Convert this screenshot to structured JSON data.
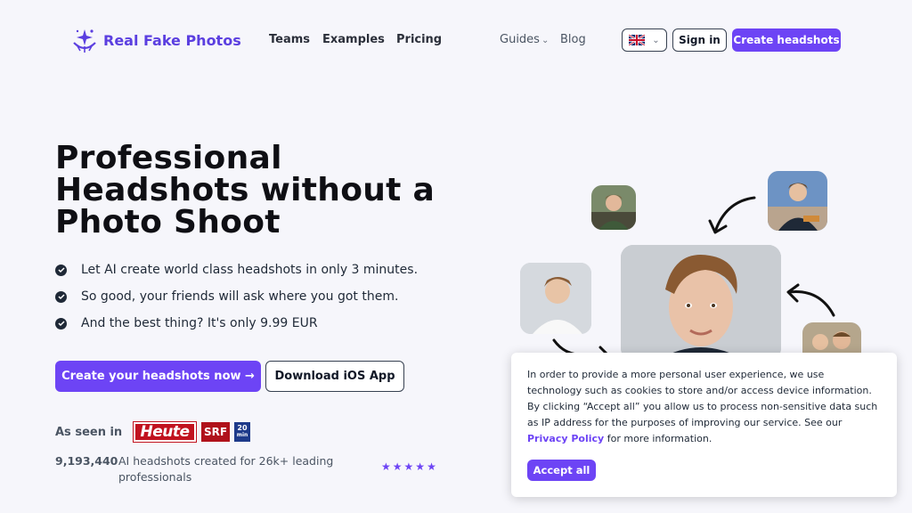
{
  "nav": {
    "logo_text": "Real Fake Photos",
    "links": [
      {
        "label": "Teams"
      },
      {
        "label": "Examples"
      },
      {
        "label": "Pricing"
      }
    ],
    "guides_label": "Guides",
    "blog_label": "Blog",
    "sign_in_label": "Sign in",
    "create_label": "Create headshots"
  },
  "hero": {
    "title": "Professional Headshots without a Photo Shoot",
    "features": [
      "Let AI create world class headshots in only 3 minutes.",
      "So good, your friends will ask where you got them.",
      "And the best thing? It's only 9.99 EUR"
    ],
    "cta_primary": "Create your headshots now →",
    "cta_secondary": "Download iOS App",
    "seen_in_label": "As seen in",
    "press": {
      "heute": "Heute",
      "srf": "SRF",
      "twenty_top": "20",
      "twenty_bottom": "min"
    },
    "stat_number": "9,193,440",
    "stat_text": "AI headshots created for 26k+ leading professionals",
    "rating_stars": 5
  },
  "cookie": {
    "text_1": "In order to provide a more personal user experience, we use technology such as cookies to store and/or access device information.",
    "text_2": "By clicking “Accept all” you allow us to process non-sensitive data such as IP address for the purposes of improving our service. See our",
    "policy_link": "Privacy Policy",
    "text_3": "for more information.",
    "accept_label": "Accept all"
  },
  "colors": {
    "accent": "#6d44f5",
    "background": "#f6f6fb",
    "text": "#111827"
  }
}
